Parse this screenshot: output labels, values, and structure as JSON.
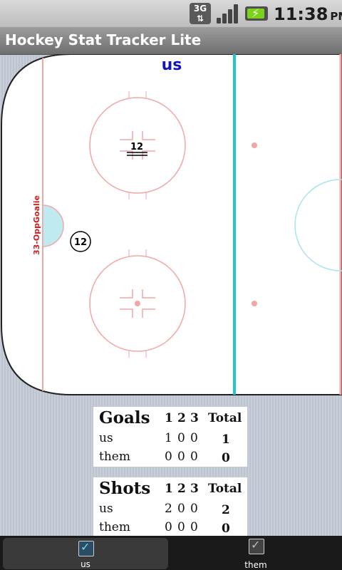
{
  "status_bar": {
    "network": "3G",
    "time": "11:38",
    "ampm": "PM",
    "icons": [
      "network-3g-icon",
      "signal-icon",
      "battery-charging-icon"
    ]
  },
  "app": {
    "title": "Hockey Stat Tracker Lite"
  },
  "rink": {
    "team_label": "us",
    "goalie_label": "33-OppGoalie",
    "player_marker_number": "12",
    "circle_marker_number": "12",
    "colors": {
      "blue_line": "#22c4d4",
      "red_lines": "#f2a6a6",
      "crease": "#bfeaf0",
      "team_label": "#1414b4",
      "goalie_label": "#d02020"
    }
  },
  "goals_table": {
    "title": "Goals",
    "periods": [
      "1",
      "2",
      "3"
    ],
    "total_label": "Total",
    "rows": [
      {
        "team": "us",
        "p1": "1",
        "p2": "0",
        "p3": "0",
        "total": "1"
      },
      {
        "team": "them",
        "p1": "0",
        "p2": "0",
        "p3": "0",
        "total": "0"
      }
    ]
  },
  "shots_table": {
    "title": "Shots",
    "periods": [
      "1",
      "2",
      "3"
    ],
    "total_label": "Total",
    "rows": [
      {
        "team": "us",
        "p1": "2",
        "p2": "0",
        "p3": "0",
        "total": "2"
      },
      {
        "team": "them",
        "p1": "0",
        "p2": "0",
        "p3": "0",
        "total": "0"
      }
    ]
  },
  "tabs": [
    {
      "label": "us",
      "selected": true,
      "icon": "checkbox-checked-icon"
    },
    {
      "label": "them",
      "selected": false,
      "icon": "checkbox-checked-icon"
    }
  ]
}
